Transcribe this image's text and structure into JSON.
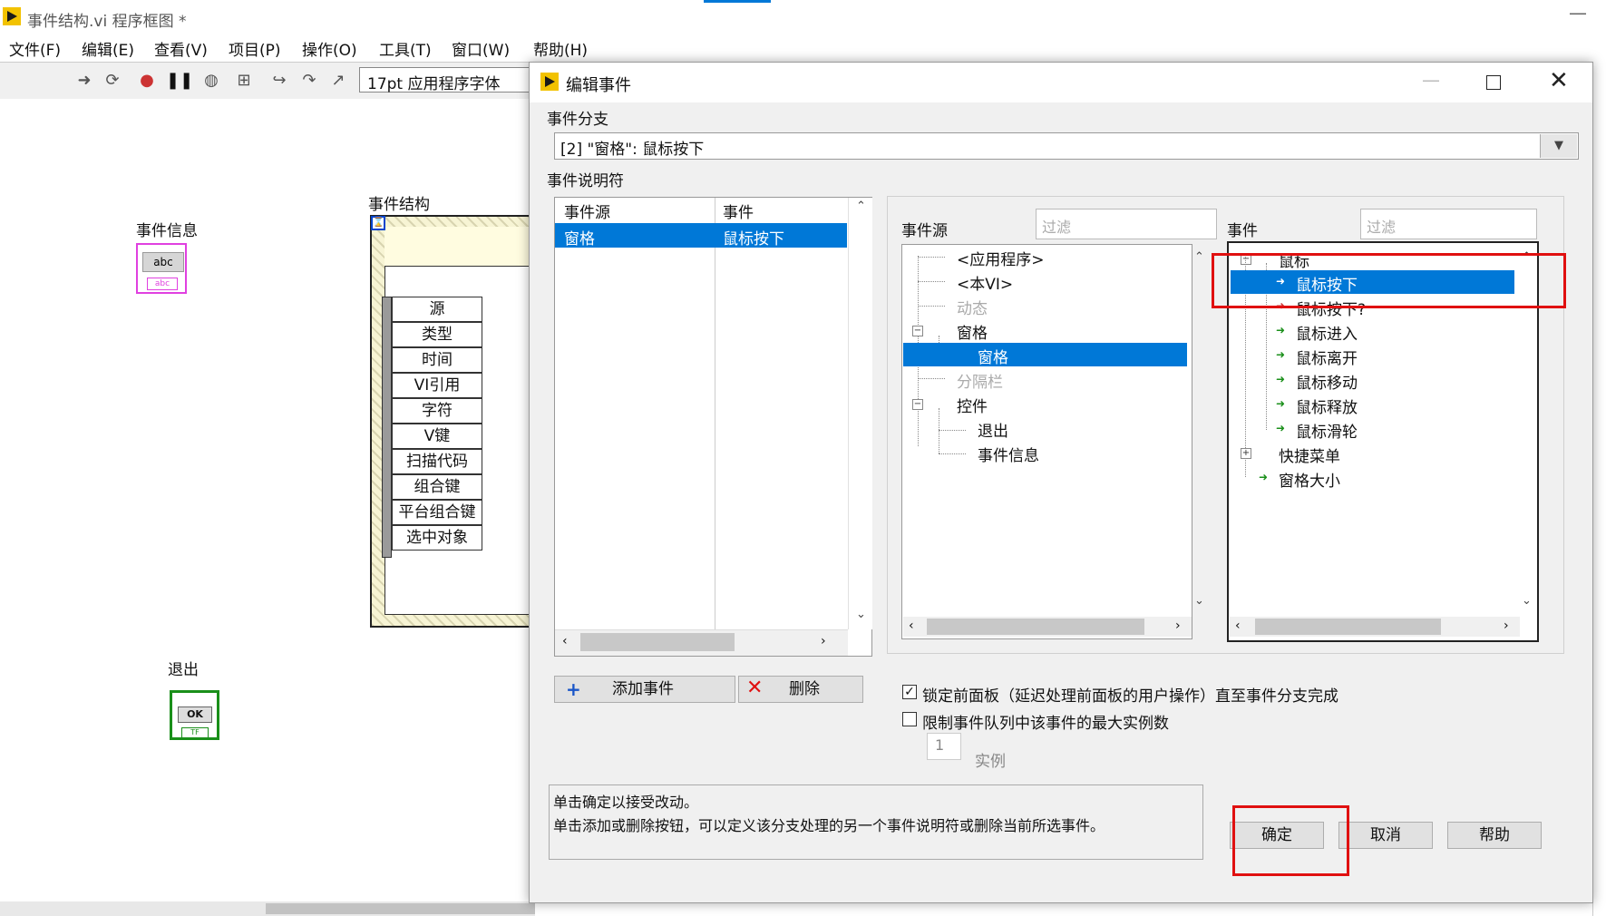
{
  "main_window": {
    "title": "事件结构.vi 程序框图 *",
    "menu": [
      "文件(F)",
      "编辑(E)",
      "查看(V)",
      "项目(P)",
      "操作(O)",
      "工具(T)",
      "窗口(W)",
      "帮助(H)"
    ],
    "font_select": "17pt 应用程序字体",
    "toolbar_icons": [
      "run-arrow-icon",
      "run-continuous-icon",
      "abort-icon",
      "pause-icon",
      "highlight-bulb-icon",
      "retain-wire-icon",
      "step-into-icon",
      "step-over-icon",
      "step-out-icon"
    ]
  },
  "block_diagram": {
    "event_info_label": "事件信息",
    "event_info_glyph": "abc",
    "event_struct_label": "事件结构",
    "exit_label": "退出",
    "exit_glyph": "OK",
    "event_data_nodes": [
      "源",
      "类型",
      "时间",
      "VI引用",
      "字符",
      "V键",
      "扫描代码",
      "组合键",
      "平台组合键",
      "选中对象"
    ]
  },
  "dialog": {
    "title": "编辑事件",
    "branch_label": "事件分支",
    "branch_value": "[2] \"窗格\": 鼠标按下",
    "specifier_label": "事件说明符",
    "spec_table": {
      "headers": [
        "事件源",
        "事件"
      ],
      "rows": [
        {
          "source": "窗格",
          "event": "鼠标按下"
        }
      ]
    },
    "source_header": "事件源",
    "source_filter_placeholder": "过滤",
    "source_tree": [
      {
        "label": "<应用程序>",
        "dim": false
      },
      {
        "label": "<本VI>",
        "dim": false
      },
      {
        "label": "动态",
        "dim": true
      },
      {
        "label": "窗格",
        "dim": false
      },
      {
        "label": "窗格",
        "dim": false,
        "selected": true
      },
      {
        "label": "分隔栏",
        "dim": true
      },
      {
        "label": "控件",
        "dim": false
      },
      {
        "label": "退出",
        "dim": false
      },
      {
        "label": "事件信息",
        "dim": false
      }
    ],
    "event_header": "事件",
    "event_filter_placeholder": "过滤",
    "event_tree": [
      {
        "label": "鼠标"
      },
      {
        "label": "鼠标按下",
        "selected": true
      },
      {
        "label": "鼠标按下?"
      },
      {
        "label": "鼠标进入"
      },
      {
        "label": "鼠标离开"
      },
      {
        "label": "鼠标移动"
      },
      {
        "label": "鼠标释放"
      },
      {
        "label": "鼠标滑轮"
      },
      {
        "label": "快捷菜单"
      },
      {
        "label": "窗格大小"
      }
    ],
    "add_event_button": "添加事件",
    "delete_button": "删除",
    "lock_panel_checkbox": {
      "label": "锁定前面板（延迟处理前面板的用户操作）直至事件分支完成",
      "checked": true
    },
    "limit_queue_checkbox": {
      "label": "限制事件队列中该事件的最大实例数",
      "checked": false
    },
    "instances_value": "1",
    "instances_label": "实例",
    "help_line1": "单击确定以接受改动。",
    "help_line2": "单击添加或删除按钮，可以定义该分支处理的另一个事件说明符或删除当前所选事件。",
    "ok_button": "确定",
    "cancel_button": "取消",
    "help_button": "帮助"
  },
  "colors": {
    "selection": "#0078d7",
    "highlight_box": "#e01010",
    "labview_yellow": "#f2c200"
  }
}
